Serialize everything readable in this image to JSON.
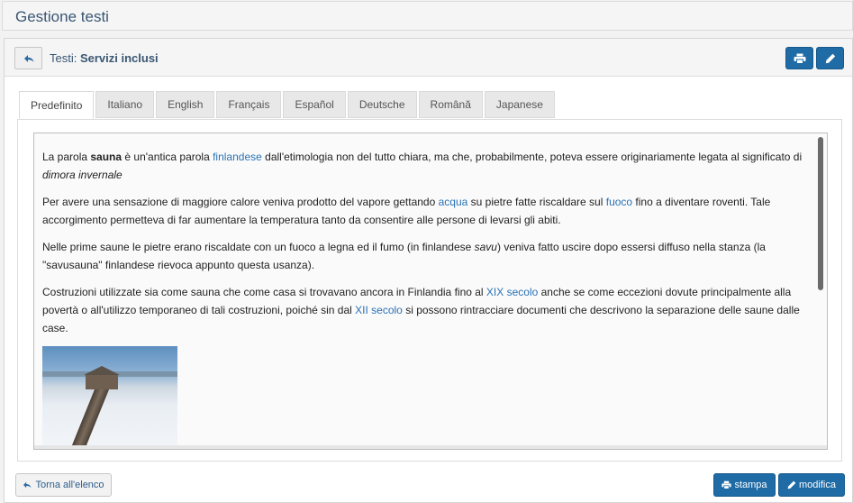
{
  "page": {
    "title": "Gestione testi"
  },
  "header": {
    "prefix": "Testi:",
    "name": "Servizi inclusi"
  },
  "tabs": [
    {
      "label": "Predefinito",
      "active": true
    },
    {
      "label": "Italiano"
    },
    {
      "label": "English"
    },
    {
      "label": "Français"
    },
    {
      "label": "Español"
    },
    {
      "label": "Deutsche"
    },
    {
      "label": "Română"
    },
    {
      "label": "Japanese"
    }
  ],
  "content": {
    "p1": {
      "t1": "La parola ",
      "b1": "sauna",
      "t2": " è un'antica parola ",
      "link1": "finlandese",
      "t3": " dall'etimologia non del tutto chiara, ma che, probabilmente, poteva essere originariamente legata al significato di ",
      "i1": "dimora invernale"
    },
    "p2": {
      "t1": "Per avere una sensazione di maggiore calore veniva prodotto del vapore gettando ",
      "link1": "acqua",
      "t2": " su pietre fatte riscaldare sul ",
      "link2": "fuoco",
      "t3": " fino a diventare roventi. Tale accorgimento permetteva di far aumentare la temperatura tanto da consentire alle persone di levarsi gli abiti."
    },
    "p3": {
      "t1": "Nelle prime saune le pietre erano riscaldate con un fuoco a legna ed il fumo (in finlandese ",
      "i1": "savu",
      "t2": ") veniva fatto uscire dopo essersi diffuso nella stanza (la \"savusauna\" finlandese rievoca appunto questa usanza)."
    },
    "p4": {
      "t1": "Costruzioni utilizzate sia come sauna che come casa si trovavano ancora in Finlandia fino al ",
      "link1": "XIX secolo",
      "t2": " anche se come eccezioni dovute principalmente alla povertà o all'utilizzo temporaneo di tali costruzioni, poiché sin dal ",
      "link2": "XII secolo",
      "t3": " si possono rintracciare documenti che descrivono la separazione delle saune dalle case."
    }
  },
  "footer": {
    "back_label": "Torna all'elenco",
    "print_label": "stampa",
    "modify_label": "modifica"
  },
  "colors": {
    "primary": "#1e6ba6",
    "link": "#2a72b5",
    "title": "#3a5673"
  }
}
